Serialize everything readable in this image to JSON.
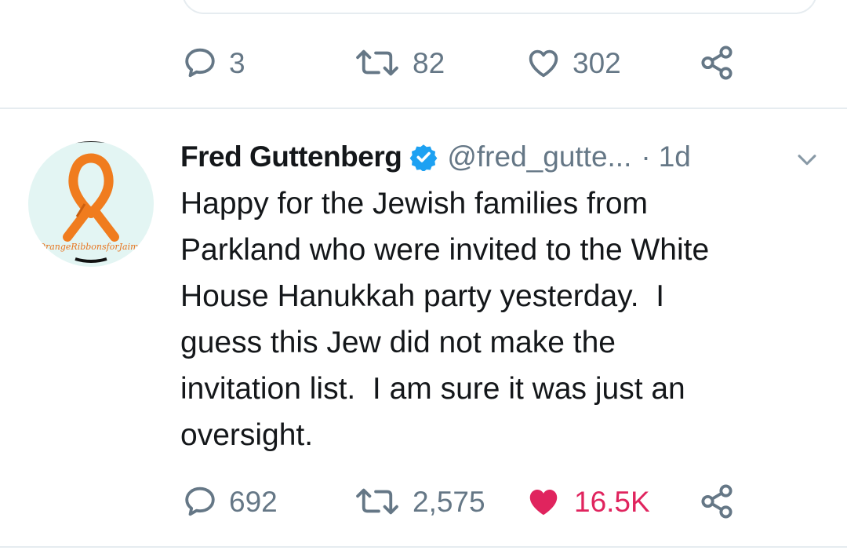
{
  "previous_tweet": {
    "actions": {
      "reply_count": "3",
      "retweet_count": "82",
      "like_count": "302"
    }
  },
  "tweet": {
    "display_name": "Fred Guttenberg",
    "handle": "@fred_gutte...",
    "separator": "·",
    "timestamp": "1d",
    "avatar_text": "OrangeRibbonsforJaime",
    "text": "Happy for the Jewish families from\nParkland who were invited to the White\nHouse Hanukkah party yesterday.  I\nguess this Jew did not make the\ninvitation list.  I am sure it was just an\noversight.",
    "actions": {
      "reply_count": "692",
      "retweet_count": "2,575",
      "like_count": "16.5K",
      "liked": true
    }
  },
  "icons": {
    "reply": "reply-icon",
    "retweet": "retweet-icon",
    "like": "heart-icon",
    "share": "share-icon",
    "verified": "verified-badge-icon",
    "menu": "chevron-down-icon"
  },
  "colors": {
    "text_primary": "#14171a",
    "text_secondary": "#657786",
    "verified_blue": "#1da1f2",
    "like_red": "#e0245e",
    "divider": "#e6ecf0",
    "avatar_ribbon": "#f07c1e"
  }
}
